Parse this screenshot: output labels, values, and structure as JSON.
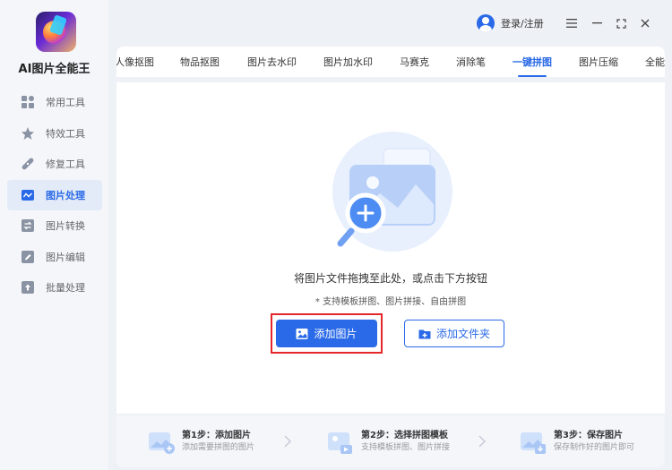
{
  "app": {
    "title": "AI图片全能王"
  },
  "sidebar": {
    "items": [
      {
        "label": "常用工具",
        "icon": "grid-icon",
        "active": false
      },
      {
        "label": "特效工具",
        "icon": "star-icon",
        "active": false
      },
      {
        "label": "修复工具",
        "icon": "bandage-icon",
        "active": false
      },
      {
        "label": "图片处理",
        "icon": "image-wave-icon",
        "active": true
      },
      {
        "label": "图片转换",
        "icon": "convert-icon",
        "active": false
      },
      {
        "label": "图片编辑",
        "icon": "edit-icon",
        "active": false
      },
      {
        "label": "批量处理",
        "icon": "upload-icon",
        "active": false
      }
    ]
  },
  "header": {
    "login_label": "登录/注册"
  },
  "tabs": [
    {
      "label": "人像抠图",
      "active": false
    },
    {
      "label": "物品抠图",
      "active": false
    },
    {
      "label": "图片去水印",
      "active": false
    },
    {
      "label": "图片加水印",
      "active": false
    },
    {
      "label": "马赛克",
      "active": false
    },
    {
      "label": "消除笔",
      "active": false
    },
    {
      "label": "一键拼图",
      "active": true
    },
    {
      "label": "图片压缩",
      "active": false
    },
    {
      "label": "全能",
      "active": false
    }
  ],
  "upload": {
    "hint": "将图片文件拖拽至此处，或点击下方按钮",
    "sub_hint": "* 支持模板拼图、图片拼接、自由拼图",
    "add_image_label": "添加图片",
    "add_folder_label": "添加文件夹"
  },
  "steps": [
    {
      "title": "第1步：添加图片",
      "desc": "添加需要拼图的图片"
    },
    {
      "title": "第2步：选择拼图模板",
      "desc": "支持模板拼图、图片拼接"
    },
    {
      "title": "第3步：保存图片",
      "desc": "保存制作好的图片即可"
    }
  ],
  "colors": {
    "accent": "#2a6ae8",
    "highlight": "#e5262b"
  }
}
